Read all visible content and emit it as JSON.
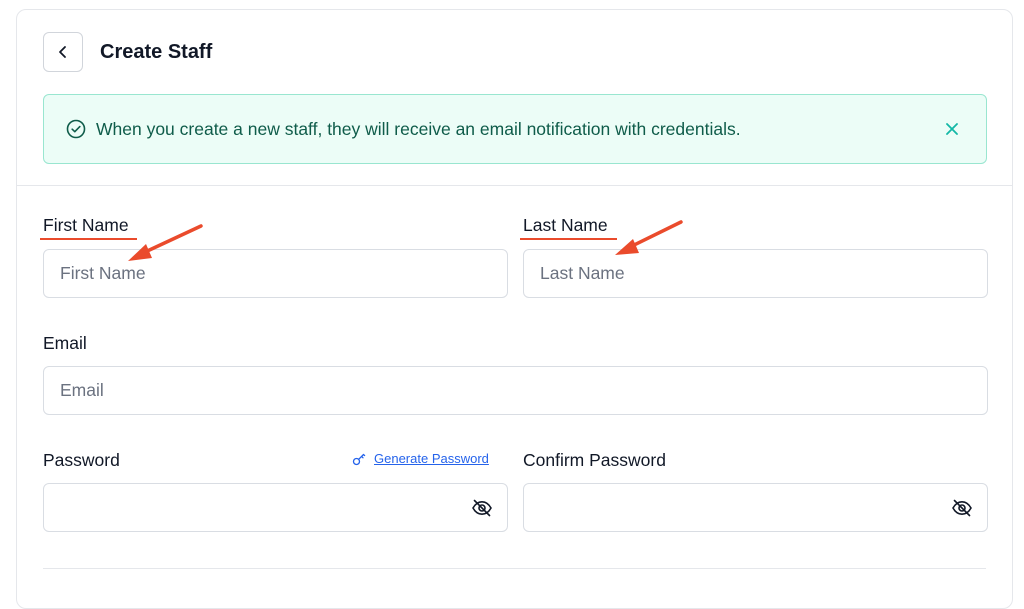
{
  "header": {
    "title": "Create Staff",
    "back_icon": "chevron-left-icon"
  },
  "alert": {
    "message": "When you create a new staff, they will receive an email notification with credentials.",
    "icon": "check-circle-icon",
    "close_icon": "close-icon",
    "color": "#0f5c4a"
  },
  "form": {
    "first_name": {
      "label": "First Name",
      "placeholder": "First Name",
      "value": ""
    },
    "last_name": {
      "label": "Last Name",
      "placeholder": "Last Name",
      "value": ""
    },
    "email": {
      "label": "Email",
      "placeholder": "Email",
      "value": ""
    },
    "password": {
      "label": "Password",
      "value": "",
      "icon": "eye-off-icon"
    },
    "generate_password": {
      "label": "Generate Password",
      "icon": "key-icon",
      "color": "#2563eb"
    },
    "confirm_password": {
      "label": "Confirm Password",
      "value": "",
      "icon": "eye-off-icon"
    }
  },
  "annotations": {
    "color": "#ea4b2c"
  }
}
